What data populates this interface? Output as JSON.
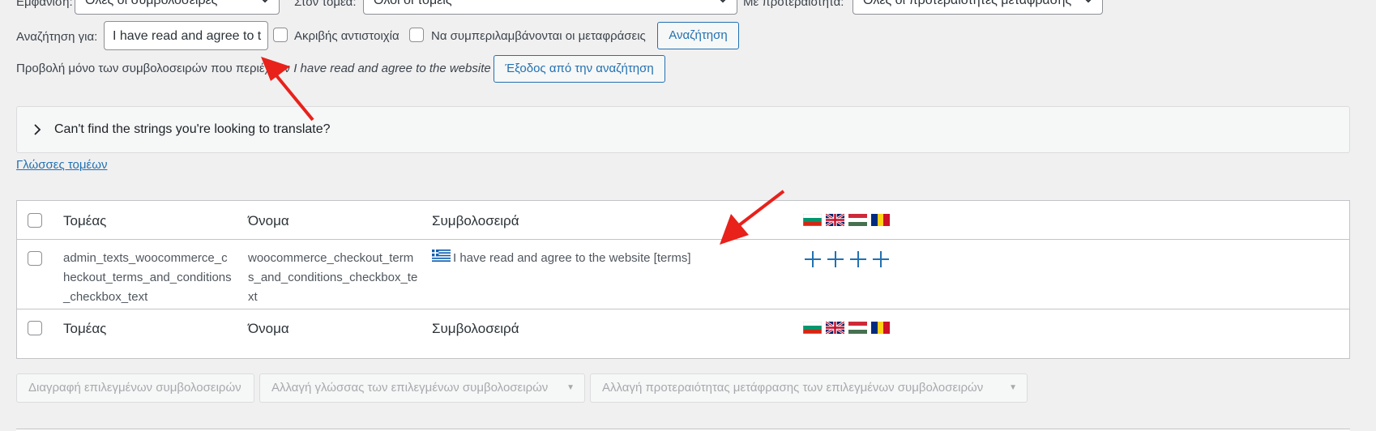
{
  "filters": {
    "show_label": "Εμφάνιση:",
    "show_value": "Όλες οι συμβολοσειρές",
    "domain_label": "Στον τομέα:",
    "domain_value": "Όλοι οι τομείς",
    "priority_label": "Με προτεραιότητα:",
    "priority_value": "Όλες οι προτεραιότητες μετάφρασης"
  },
  "search": {
    "label": "Αναζήτηση για:",
    "value": "I have read and agree to t",
    "exact_match_label": "Ακριβής αντιστοιχία",
    "include_translations_label": "Να συμπεριλαμβάνονται οι μεταφράσεις",
    "button": "Αναζήτηση"
  },
  "notice": {
    "prefix": "Προβολή μόνο των συμβολοσειρών που περιέχουν",
    "term": "I have read and agree to the website",
    "exit_button": "Έξοδος από την αναζήτηση"
  },
  "help_panel": {
    "title": "Can't find the strings you're looking to translate?"
  },
  "domain_languages_link": "Γλώσσες τομέων",
  "table": {
    "headers": {
      "domain": "Τομέας",
      "name": "Όνομα",
      "string": "Συμβολοσειρά"
    },
    "rows": [
      {
        "domain": "admin_texts_woocommerce_checkout_terms_and_conditions_checkbox_text",
        "name": "woocommerce_checkout_terms_and_conditions_checkbox_text",
        "string": "I have read and agree to the website [terms]"
      }
    ],
    "language_flags": [
      "flag-bulgaria-icon",
      "flag-uk-icon",
      "flag-hungary-icon",
      "flag-romania-icon"
    ],
    "source_flag": "flag-greece-icon"
  },
  "bulk_actions": {
    "delete": "Διαγραφή επιλεγμένων συμβολοσειρών",
    "change_language": "Αλλαγή γλώσσας των επιλεγμένων συμβολοσειρών",
    "change_priority": "Αλλαγή προτεραιότητας μετάφρασης των επιλεγμένων συμβολοσειρών"
  },
  "colors": {
    "accent": "#2271b1",
    "annotation_arrow": "#e8211b"
  }
}
